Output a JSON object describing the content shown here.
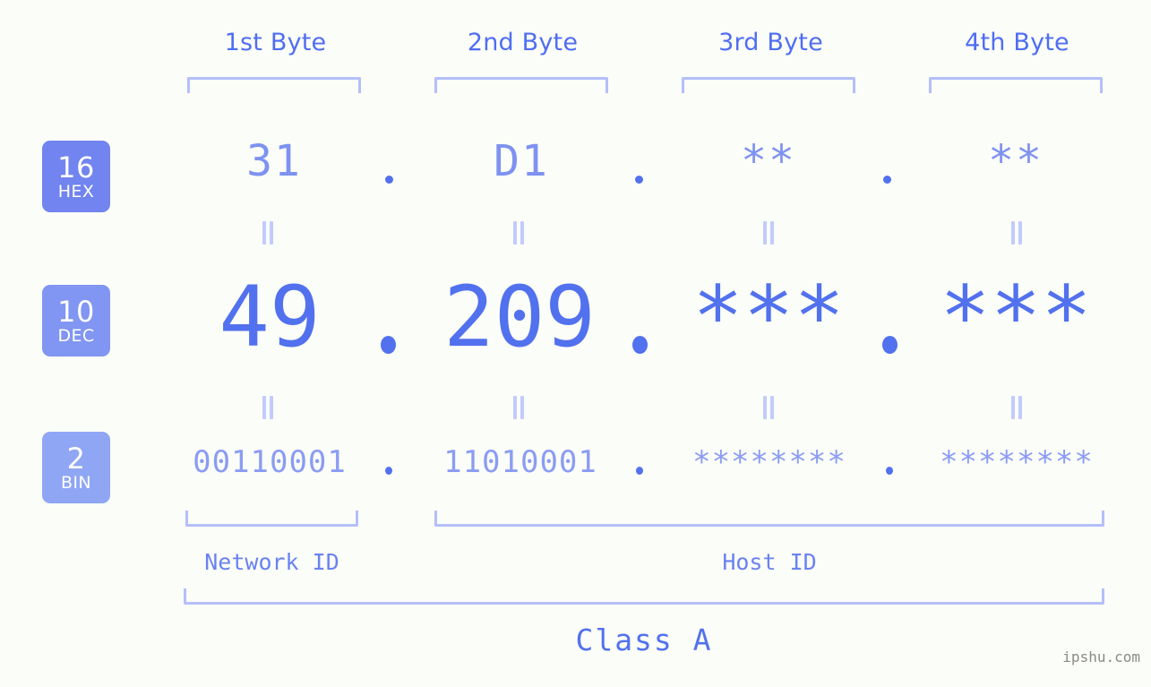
{
  "page": {
    "background_color": "#fbfdf8",
    "accent_color": "#5271ee",
    "light_accent_color": "#b4bffb",
    "watermark": "ipshu.com"
  },
  "byte_headers": [
    {
      "label": "1st Byte"
    },
    {
      "label": "2nd Byte"
    },
    {
      "label": "3rd Byte"
    },
    {
      "label": "4th Byte"
    }
  ],
  "rows": [
    {
      "badge_number": "16",
      "badge_name": "HEX",
      "badge_color": "#7184ef",
      "values": [
        "31",
        "D1",
        "**",
        "**"
      ],
      "separator": "."
    },
    {
      "badge_number": "10",
      "badge_name": "DEC",
      "badge_color": "#8195f2",
      "values": [
        "49",
        "209",
        "***",
        "***"
      ],
      "separator": "."
    },
    {
      "badge_number": "2",
      "badge_name": "BIN",
      "badge_color": "#8fa6f4",
      "values": [
        "00110001",
        "11010001",
        "********",
        "********"
      ],
      "separator": "."
    }
  ],
  "equals_symbol": "=",
  "id_labels": {
    "network": "Network ID",
    "host": "Host ID"
  },
  "class_label": "Class A"
}
